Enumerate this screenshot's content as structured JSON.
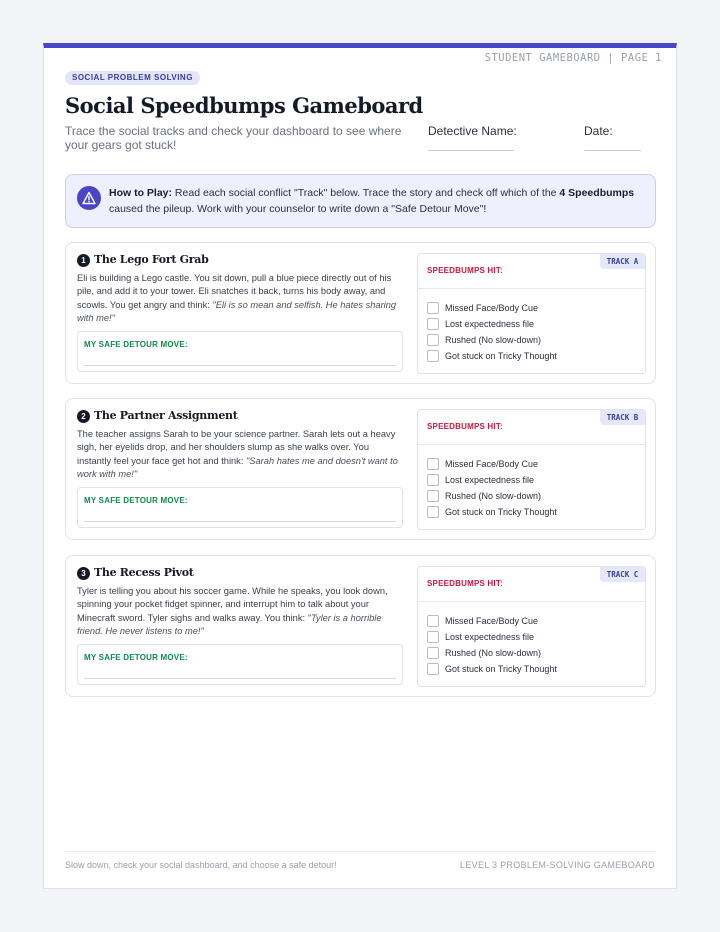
{
  "header": {
    "page_label": "STUDENT GAMEBOARD | PAGE 1",
    "category": "SOCIAL PROBLEM SOLVING",
    "title": "Social Speedbumps Gameboard",
    "subtitle": "Trace the social tracks and check your dashboard to see where your gears got stuck!",
    "detective_label": "Detective Name:",
    "date_label": "Date:"
  },
  "howto": {
    "icon": "warning-triangle-icon",
    "lead": "How to Play:",
    "text_before": " Read each social conflict \"Track\" below. Trace the story and check off which of the ",
    "bold": "4 Speedbumps",
    "text_after": " caused the pileup. Work with your counselor to write down a \"Safe Detour Move\"!"
  },
  "colors": {
    "accent": "#4b45c9",
    "speedbump_red": "#c8183e",
    "detour_green": "#0f8a4c"
  },
  "tracks": [
    {
      "number": "1",
      "title": "The Lego Fort Grab",
      "story": "Eli is building a Lego castle. You sit down, pull a blue piece directly out of his pile, and add it to your tower. Eli snatches it back, turns his body away, and scowls. You get angry and think: ",
      "thought": "\"Eli is so mean and selfish. He hates sharing with me!\"",
      "detour_label": "MY SAFE DETOUR MOVE:",
      "track_tag": "TRACK A",
      "speedbumps_label": "SPEEDBUMPS HIT:",
      "options": [
        "Missed Face/Body Cue",
        "Lost expectedness file",
        "Rushed (No slow-down)",
        "Got stuck on Tricky Thought"
      ]
    },
    {
      "number": "2",
      "title": "The Partner Assignment",
      "story": "The teacher assigns Sarah to be your science partner. Sarah lets out a heavy sigh, her eyelids drop, and her shoulders slump as she walks over. You instantly feel your face get hot and think: ",
      "thought": "\"Sarah hates me and doesn't want to work with me!\"",
      "detour_label": "MY SAFE DETOUR MOVE:",
      "track_tag": "TRACK B",
      "speedbumps_label": "SPEEDBUMPS HIT:",
      "options": [
        "Missed Face/Body Cue",
        "Lost expectedness file",
        "Rushed (No slow-down)",
        "Got stuck on Tricky Thought"
      ]
    },
    {
      "number": "3",
      "title": "The Recess Pivot",
      "story": "Tyler is telling you about his soccer game. While he speaks, you look down, spinning your pocket fidget spinner, and interrupt him to talk about your Minecraft sword. Tyler sighs and walks away. You think: ",
      "thought": "\"Tyler is a horrible friend. He never listens to me!\"",
      "detour_label": "MY SAFE DETOUR MOVE:",
      "track_tag": "TRACK C",
      "speedbumps_label": "SPEEDBUMPS HIT:",
      "options": [
        "Missed Face/Body Cue",
        "Lost expectedness file",
        "Rushed (No slow-down)",
        "Got stuck on Tricky Thought"
      ]
    }
  ],
  "footer": {
    "left": "Slow down, check your social dashboard, and choose a safe detour!",
    "right": "LEVEL 3 PROBLEM-SOLVING GAMEBOARD"
  }
}
